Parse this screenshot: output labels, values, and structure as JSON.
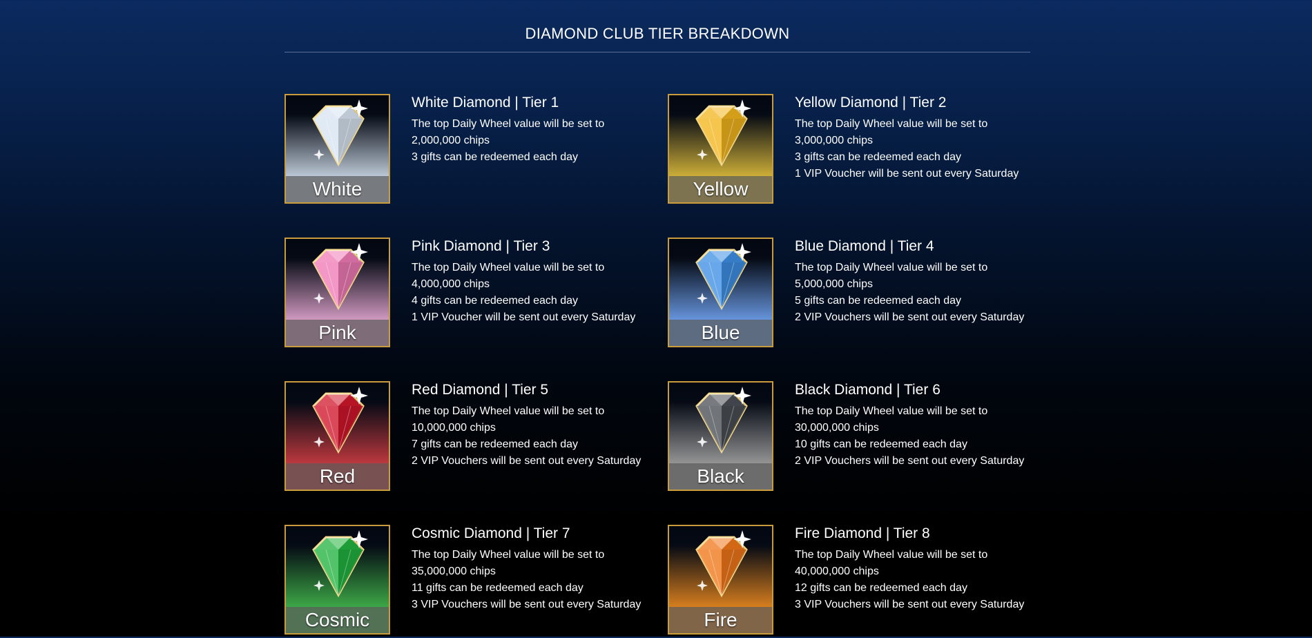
{
  "page_title": "DIAMOND CLUB TIER BREAKDOWN",
  "tiers": [
    {
      "label": "White",
      "title": "White Diamond | Tier 1",
      "gem_color": "#d8e4f2",
      "glow_color": "#c3cfdd",
      "lines": [
        "The top Daily Wheel value will be set to",
        "2,000,000 chips",
        "3 gifts can be redeemed each day"
      ]
    },
    {
      "label": "Yellow",
      "title": "Yellow Diamond | Tier 2",
      "gem_color": "#f2b51c",
      "glow_color": "#d6b53a",
      "lines": [
        "The top Daily Wheel value will be set to",
        "3,000,000 chips",
        "3 gifts can be redeemed each day",
        "1 VIP Voucher will be sent out every Saturday"
      ]
    },
    {
      "label": "Pink",
      "title": "Pink Diamond | Tier 3",
      "gem_color": "#f07ab6",
      "glow_color": "#d99fc7",
      "lines": [
        "The top Daily Wheel value will be set to",
        "4,000,000 chips",
        "4 gifts can be redeemed each day",
        "1 VIP Voucher will be sent out every Saturday"
      ]
    },
    {
      "label": "Blue",
      "title": "Blue Diamond | Tier 4",
      "gem_color": "#3e8fe4",
      "glow_color": "#6a9ae4",
      "lines": [
        "The top Daily Wheel value will be set to",
        "5,000,000 chips",
        "5 gifts can be redeemed each day",
        "2 VIP Vouchers will be sent out every Saturday"
      ]
    },
    {
      "label": "Red",
      "title": "Red Diamond | Tier 5",
      "gem_color": "#d0182c",
      "glow_color": "#c43a40",
      "lines": [
        "The top Daily Wheel value will be set to",
        "10,000,000 chips",
        "7 gifts can be redeemed each day",
        "2 VIP Vouchers will be sent out every Saturday"
      ]
    },
    {
      "label": "Black",
      "title": "Black Diamond | Tier 6",
      "gem_color": "#4a4e55",
      "glow_color": "#9a9a9a",
      "lines": [
        "The top Daily Wheel value will be set to",
        "30,000,000 chips",
        "10 gifts can be redeemed each day",
        "2 VIP Vouchers will be sent out every Saturday"
      ]
    },
    {
      "label": "Cosmic",
      "title": "Cosmic Diamond | Tier 7",
      "gem_color": "#22b23f",
      "glow_color": "#3fae48",
      "lines": [
        "The top Daily Wheel value will be set to",
        "35,000,000 chips",
        "11 gifts can be redeemed each day",
        "3 VIP Vouchers will be sent out every Saturday"
      ]
    },
    {
      "label": "Fire",
      "title": "Fire Diamond | Tier 8",
      "gem_color": "#f0771a",
      "glow_color": "#e0831f",
      "lines": [
        "The top Daily Wheel value will be set to",
        "40,000,000 chips",
        "12 gifts can be redeemed each day",
        "3 VIP Vouchers will be sent out every Saturday"
      ]
    }
  ]
}
